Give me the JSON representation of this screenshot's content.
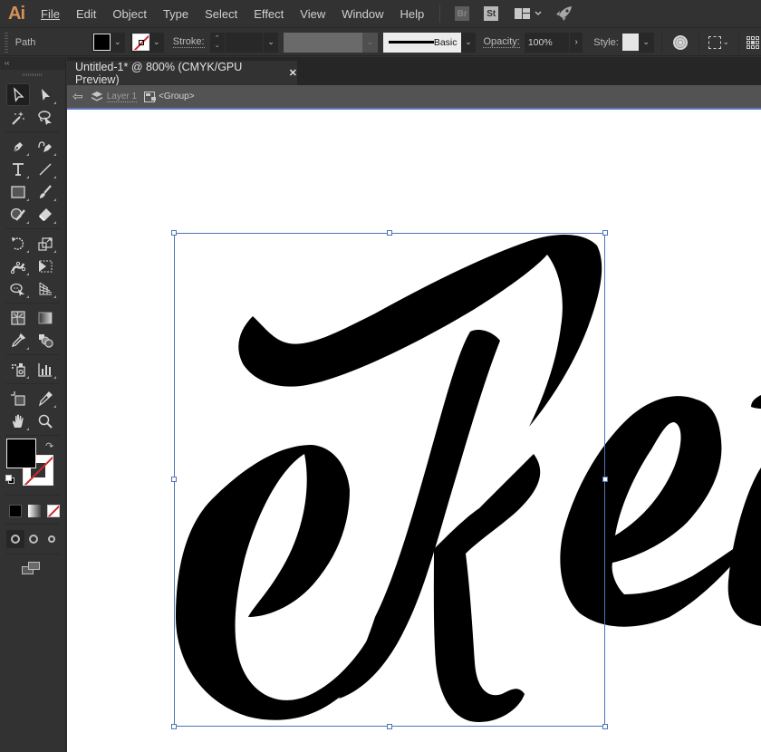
{
  "app": {
    "logo": "Ai",
    "menu": [
      "File",
      "Edit",
      "Object",
      "Type",
      "Select",
      "Effect",
      "View",
      "Window",
      "Help"
    ],
    "menu_underline_index": [
      0,
      0,
      0,
      0,
      0,
      4,
      0,
      0,
      0
    ],
    "bridge_label": "Br",
    "stock_label": "St",
    "icons": [
      "bridge-icon",
      "stock-icon",
      "workspace-switcher-icon",
      "publish-rocket-icon"
    ]
  },
  "control_bar": {
    "selection_type": "Path",
    "fill_color": "#000000",
    "stroke_color": "none",
    "stroke_label": "Stroke:",
    "stroke_weight": "",
    "variable_width_profile": "",
    "brush_definition": "Basic",
    "opacity_label": "Opacity:",
    "opacity_value": "100%",
    "style_label": "Style:",
    "icons": [
      "recolor-artwork-icon",
      "transform-icon",
      "align-icon"
    ]
  },
  "document": {
    "tab_title": "Untitled-1* @ 800% (CMYK/GPU Preview)",
    "close_glyph": "✕",
    "breadcrumb": {
      "layer": "Layer 1",
      "group": "<Group>"
    }
  },
  "toolbar": {
    "collapse_glyph": "‹‹",
    "tools": [
      [
        "selection-tool",
        "direct-selection-tool"
      ],
      [
        "magic-wand-tool",
        "lasso-tool"
      ],
      [
        "pen-tool",
        "curvature-tool"
      ],
      [
        "type-tool",
        "line-segment-tool"
      ],
      [
        "rectangle-tool",
        "paintbrush-tool"
      ],
      [
        "shaper-tool",
        "eraser-tool"
      ],
      [
        "rotate-tool",
        "scale-tool"
      ],
      [
        "puppet-warp-tool",
        "free-transform-tool"
      ],
      [
        "shape-builder-tool",
        "perspective-grid-tool"
      ],
      [
        "mesh-tool",
        "gradient-tool"
      ],
      [
        "eyedropper-tool",
        "blend-tool"
      ],
      [
        "symbol-sprayer-tool",
        "column-graph-tool"
      ],
      [
        "artboard-tool",
        "slice-tool"
      ],
      [
        "hand-tool",
        "zoom-tool"
      ]
    ],
    "active_tool": "selection-tool",
    "fill_color": "#000000",
    "stroke_color": "none",
    "accent_none_color": "#d3262b"
  },
  "canvas": {
    "background": "#ffffff",
    "artwork_text": "Rei",
    "selection_color": "#4e74b5",
    "selection": "Group"
  }
}
